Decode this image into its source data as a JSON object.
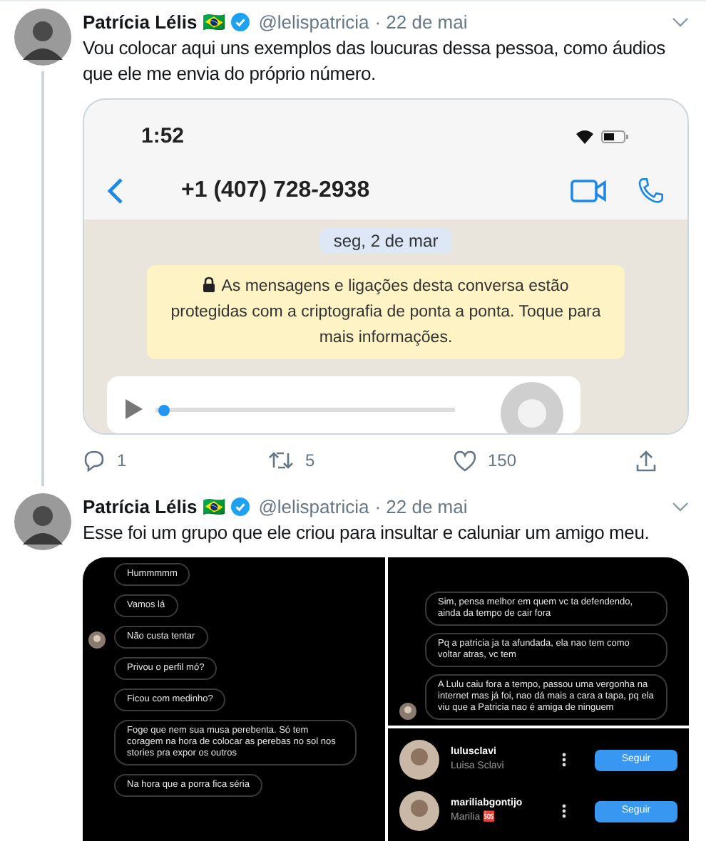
{
  "tweets": [
    {
      "author": "Patrícia Lélis",
      "flag": "🇧🇷",
      "verified": true,
      "handle": "@lelispatricia",
      "date": "· 22 de mai",
      "text": "Vou colocar aqui uns exemplos das loucuras dessa pessoa, como áudios que ele me envia do próprio número.",
      "media": {
        "kind": "whatsapp",
        "time": "1:52",
        "contact": "+1 (407) 728-2938",
        "date_chip": "seg, 2 de mar",
        "notice": "As mensagens e ligações desta conversa estão protegidas com a criptografia de ponta a ponta. Toque para mais informações.",
        "audio": {
          "level": 0.03
        }
      },
      "actions": {
        "replies": "1",
        "retweets": "5",
        "likes": "150"
      }
    },
    {
      "author": "Patrícia Lélis",
      "flag": "🇧🇷",
      "verified": true,
      "handle": "@lelispatricia",
      "date": "· 22 de mai",
      "text": "Esse foi um grupo que ele criou para insultar e caluniar um amigo meu.",
      "media": {
        "kind": "instagram_collage",
        "left_messages": [
          {
            "text": "Hummmmm",
            "avatar": false
          },
          {
            "text": "Vamos lá",
            "avatar": false
          },
          {
            "text": "Não custa tentar",
            "avatar": true
          },
          {
            "text": "Privou o perfil mó?",
            "avatar": false
          },
          {
            "text": "Ficou com medinho?",
            "avatar": false
          },
          {
            "text": "Foge que nem sua musa perebenta. Só tem coragem na hora de colocar as perebas no sol nos stories pra expor os outros",
            "avatar": false
          },
          {
            "text": "Na hora que a porra fica séria",
            "avatar": false
          }
        ],
        "right_messages": [
          {
            "text": "Sim, pensa melhor em quem vc ta defendendo, ainda da tempo de cair fora",
            "avatar": false
          },
          {
            "text": "Pq a patricia ja ta afundada, ela nao tem como voltar atras, vc tem",
            "avatar": false
          },
          {
            "text": "A Lulu caiu fora a tempo, passou uma vergonha na internet mas já foi, nao dá mais a cara a tapa, pq ela viu que a Patricia nao é amiga de ninguem",
            "avatar": true
          }
        ],
        "accounts": [
          {
            "username": "lulusclavi",
            "name": "Luisa Sclavi",
            "button": "Seguir"
          },
          {
            "username": "mariliabgontijo",
            "name": "Marilia 🆘",
            "button": "Seguir"
          }
        ]
      }
    }
  ]
}
